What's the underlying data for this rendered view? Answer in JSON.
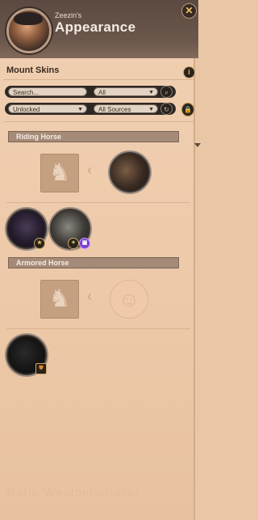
{
  "header": {
    "username": "Zeezin's",
    "title": "Appearance",
    "close_glyph": "✕",
    "avatar_icon": "character-portrait-icon"
  },
  "section": {
    "title": "Mount Skins",
    "info_glyph": "i"
  },
  "filters": {
    "search_placeholder": "Search...",
    "type_select": "All",
    "ownership_select": "Unlocked",
    "source_select": "All Sources"
  },
  "categories": [
    {
      "name": "Riding Horse",
      "skins": [
        {
          "name": "riding-horse-default-skin"
        },
        {
          "name": "riding-horse-witch-skin"
        },
        {
          "name": "riding-horse-armored-skin"
        }
      ]
    },
    {
      "name": "Armored Horse",
      "skins": [
        {
          "name": "armored-horse-dark-skin"
        }
      ]
    }
  ],
  "watermark_text": "Ratio Westmiristraror"
}
